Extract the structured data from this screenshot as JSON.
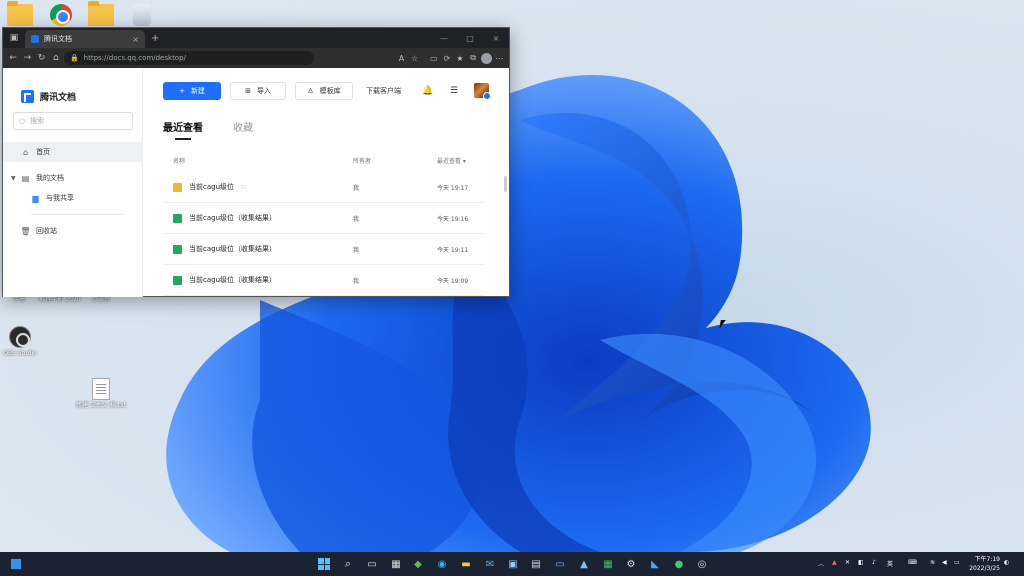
{
  "desktop": {
    "icons": [
      {
        "label": ""
      },
      {
        "label": ""
      },
      {
        "label": ""
      },
      {
        "label": ""
      },
      {
        "label": "手册"
      },
      {
        "label": "教程手册 2020"
      },
      {
        "label": "点击查"
      },
      {
        "label": "OBS Studio"
      },
      {
        "label": "新建 文本文 档.txt"
      }
    ]
  },
  "browser": {
    "tab_title": "腾讯文档",
    "tab_close": "×",
    "new_tab": "+",
    "url": "https://docs.qq.com/desktop/",
    "window_controls": {
      "minimize": "—",
      "maximize": "□",
      "close": "×"
    }
  },
  "app": {
    "logo_text": "腾讯文档",
    "search_placeholder": "搜索",
    "sidebar": {
      "items": [
        {
          "label": "首页"
        },
        {
          "label": "我的文档"
        },
        {
          "label": "与我共享"
        },
        {
          "label": "回收站"
        }
      ]
    },
    "toolbar": {
      "new_label": "新建",
      "import_label": "导入",
      "template_label": "模板库",
      "download_label": "下载客户端"
    },
    "tabs": {
      "recent": "最近查看",
      "starred": "收藏"
    },
    "table": {
      "headers": {
        "name": "名称",
        "owner": "所有者",
        "time": "最近查看 ▾"
      },
      "rows": [
        {
          "name": "当前cagu级位",
          "owner": "我",
          "time": "今天 19:17",
          "type": "folder"
        },
        {
          "name": "当前cagu级位（收集结果）",
          "owner": "我",
          "time": "今天 19:16",
          "type": "sheet"
        },
        {
          "name": "当前cagu级位（收集结果）",
          "owner": "我",
          "time": "今天 19:11",
          "type": "sheet"
        },
        {
          "name": "当前cagu级位（收集结果）",
          "owner": "我",
          "time": "今天 19:09",
          "type": "sheet"
        }
      ]
    }
  },
  "taskbar": {
    "ime": "英",
    "time": "下午7:19",
    "date": "2022/3/25"
  }
}
